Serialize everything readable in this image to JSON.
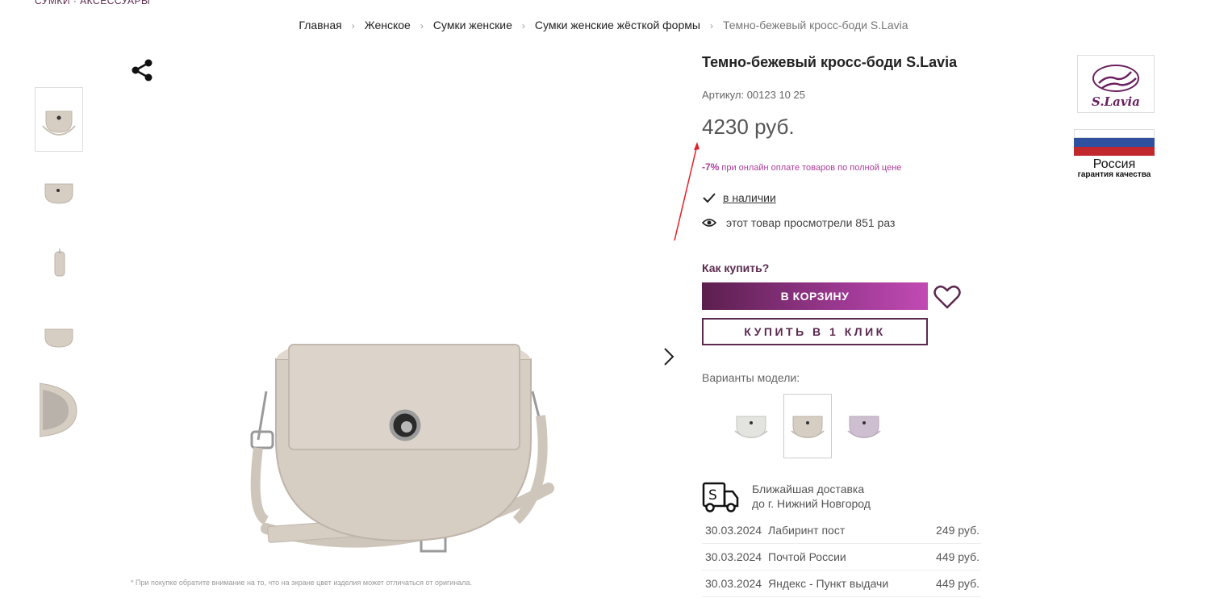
{
  "header": {
    "brand_fragment": "СУМКИ · АКСЕССУАРЫ"
  },
  "breadcrumb": {
    "items": [
      "Главная",
      "Женское",
      "Сумки женские",
      "Сумки женские жёсткой формы"
    ],
    "current": "Темно-бежевый кросс-боди S.Lavia",
    "separator": "›"
  },
  "product": {
    "title": "Темно-бежевый кросс-боди S.Lavia",
    "sku": "Артикул: 00123 10 25",
    "price": "4230 руб.",
    "discount_percent": "-7%",
    "discount_text": "при онлайн оплате товаров по полной цене",
    "stock": "в наличии",
    "views": "этот товар просмотрели 851 раз",
    "how_to_buy": "Как купить?",
    "cart_button": "В КОРЗИНУ",
    "one_click_button": "КУПИТЬ В 1 КЛИК",
    "variants_label": "Варианты модели:",
    "disclaimer": "* При покупке обратите внимание на то, что на экране цвет изделия может отличаться от оригинала."
  },
  "delivery": {
    "title_line1": "Ближайшая доставка",
    "title_line2": "до г. Нижний Новгород",
    "rows": [
      {
        "date": "30.03.2024",
        "service": "Лабиринт пост",
        "price": "249 руб."
      },
      {
        "date": "30.03.2024",
        "service": "Почтой России",
        "price": "449 руб."
      },
      {
        "date": "30.03.2024",
        "service": "Яндекс - Пункт выдачи",
        "price": "449 руб."
      }
    ]
  },
  "brand_logo": {
    "text": "S.Lavia"
  },
  "origin": {
    "country": "Россия",
    "guarantee": "гарантия качества"
  },
  "colors": {
    "accent": "#5b2a4f",
    "discount": "#b03d9a",
    "bag": "#d6cdc3",
    "annotation_arrow": "#e0202a"
  },
  "icons": [
    "share-icon",
    "check-icon",
    "eye-icon",
    "heart-icon",
    "chevron-right-icon",
    "delivery-truck-icon"
  ]
}
